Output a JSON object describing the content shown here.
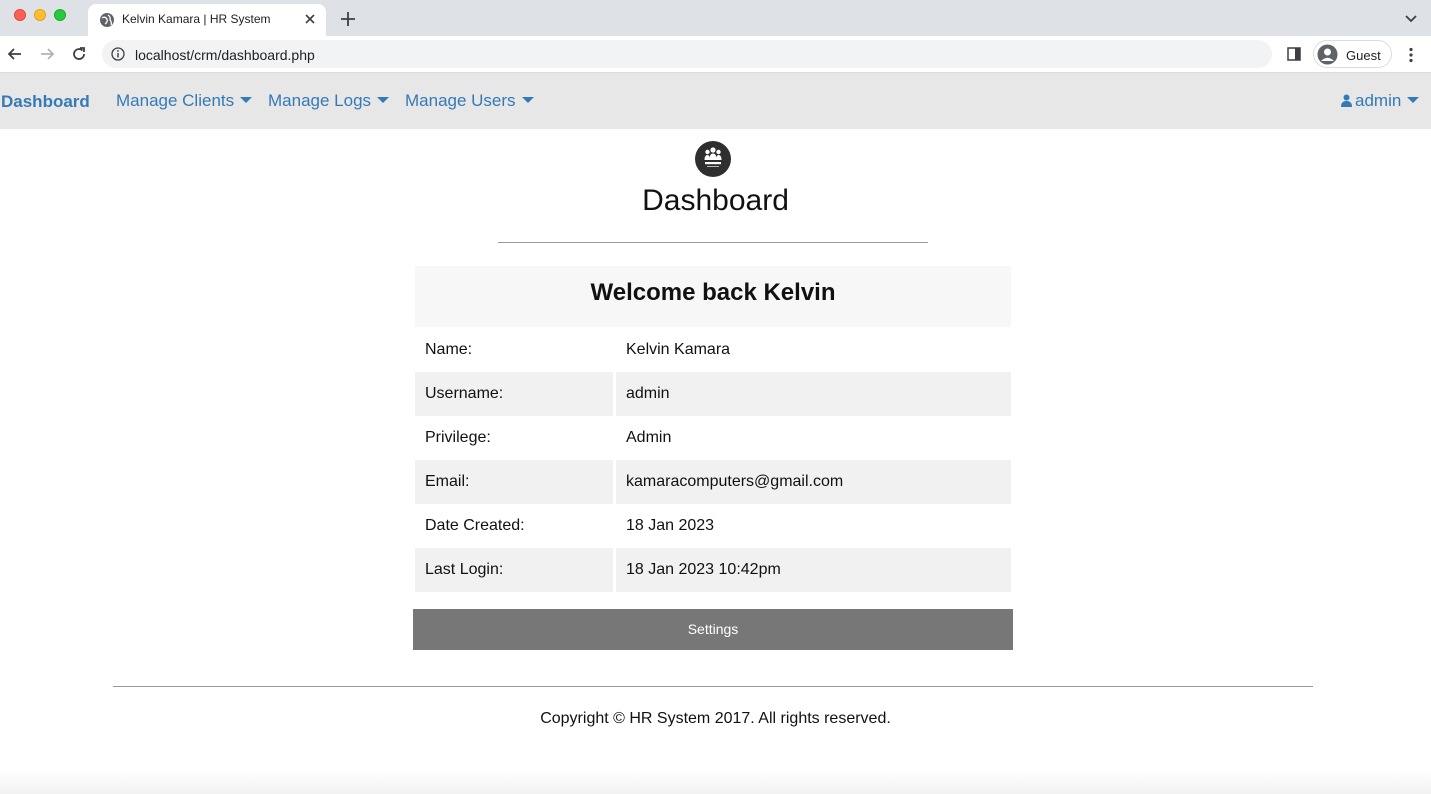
{
  "browser": {
    "tab_title": "Kelvin Kamara | HR System",
    "url": "localhost/crm/dashboard.php",
    "profile_name": "Guest"
  },
  "navbar": {
    "brand": "Dashboard",
    "items": [
      {
        "label": "Manage Clients"
      },
      {
        "label": "Manage Logs"
      },
      {
        "label": "Manage Users"
      }
    ],
    "user_menu": "admin"
  },
  "main": {
    "title": "Dashboard",
    "welcome": "Welcome back Kelvin",
    "rows": [
      {
        "label": "Name:",
        "value": "Kelvin Kamara"
      },
      {
        "label": "Username:",
        "value": "admin"
      },
      {
        "label": "Privilege:",
        "value": "Admin"
      },
      {
        "label": "Email:",
        "value": "kamaracomputers@gmail.com"
      },
      {
        "label": "Date Created:",
        "value": "18 Jan 2023"
      },
      {
        "label": "Last Login:",
        "value": "18 Jan 2023 10:42pm"
      }
    ],
    "settings_label": "Settings"
  },
  "footer": {
    "copyright": "Copyright © HR System 2017. All rights reserved."
  },
  "colors": {
    "link": "#337ab7",
    "navbar_bg": "#e7e7e7",
    "button_bg": "#777777",
    "stripe_bg": "#f1f1f1"
  }
}
